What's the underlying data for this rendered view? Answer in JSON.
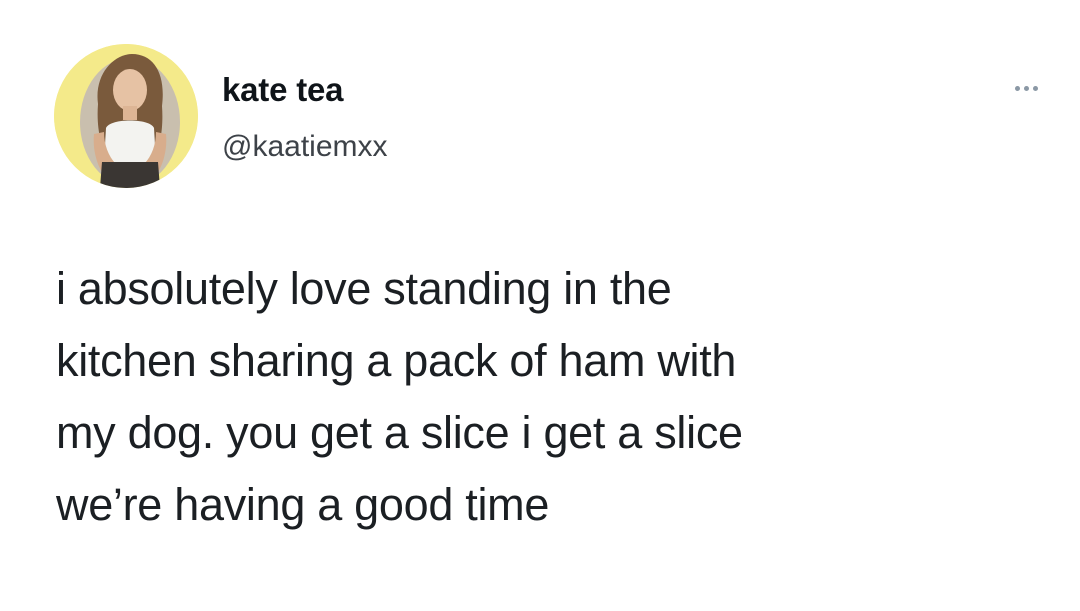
{
  "tweet": {
    "author": {
      "display_name": "kate tea",
      "handle": "@kaatiemxx",
      "avatar_icon": "profile-photo"
    },
    "more_icon": "more-options-icon",
    "text_lines": [
      "i absolutely love standing in the",
      "kitchen sharing a pack of ham with",
      "my dog. you get a slice i get a slice",
      "we’re having a good time"
    ]
  },
  "colors": {
    "avatar_ring": "#f4ea8a",
    "text": "#0f1419",
    "secondary_text": "#3d4248",
    "icon_gray": "#8b98a5"
  }
}
